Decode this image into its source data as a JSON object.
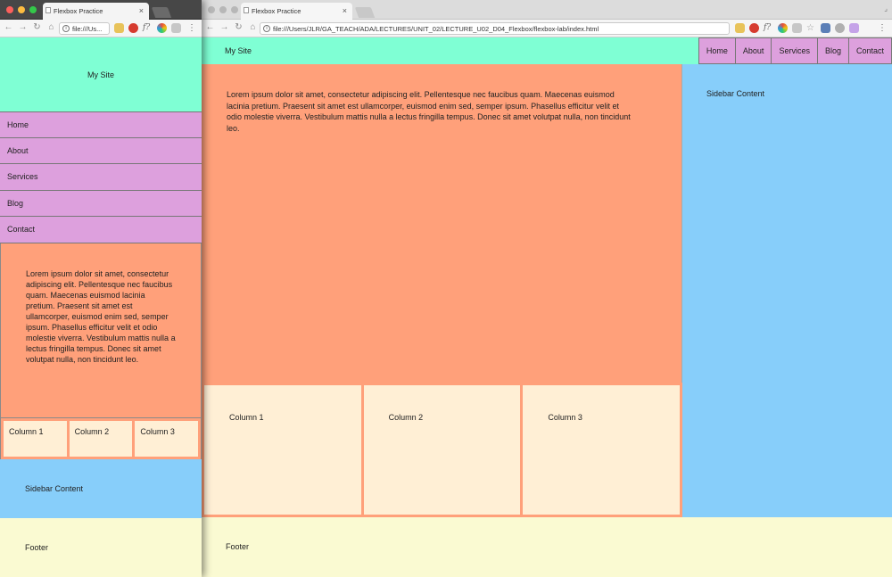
{
  "browser_back": {
    "tab_title": "Flexbox Practice",
    "url": "file:///Users/JLR/GA_TEACH/ADA/LECTURES/UNIT_02/LECTURE_U02_D04_Flexbox/flexbox-lab/index.html"
  },
  "browser_front": {
    "tab_title": "Flexbox Practice",
    "url": "file:///Us..."
  },
  "page": {
    "site_title": "My Site",
    "nav": [
      "Home",
      "About",
      "Services",
      "Blog",
      "Contact"
    ],
    "main_text": "Lorem ipsum dolor sit amet, consectetur adipiscing elit. Pellentesque nec faucibus quam. Maecenas euismod lacinia pretium. Praesent sit amet est ullamcorper, euismod enim sed, semper ipsum. Phasellus efficitur velit et odio molestie viverra. Vestibulum mattis nulla a lectus fringilla tempus. Donec sit amet volutpat nulla, non tincidunt leo.",
    "columns": [
      "Column 1",
      "Column 2",
      "Column 3"
    ],
    "sidebar": "Sidebar Content",
    "footer": "Footer"
  },
  "colors": {
    "header": "#7fffd4",
    "nav": "#dda0dd",
    "main": "#ffa07a",
    "column": "#ffefd5",
    "sidebar": "#87cefa",
    "footer": "#fafad2"
  },
  "icons": [
    "back-icon",
    "forward-icon",
    "reload-icon",
    "home-icon",
    "info-icon",
    "star-icon",
    "menu-icon"
  ]
}
